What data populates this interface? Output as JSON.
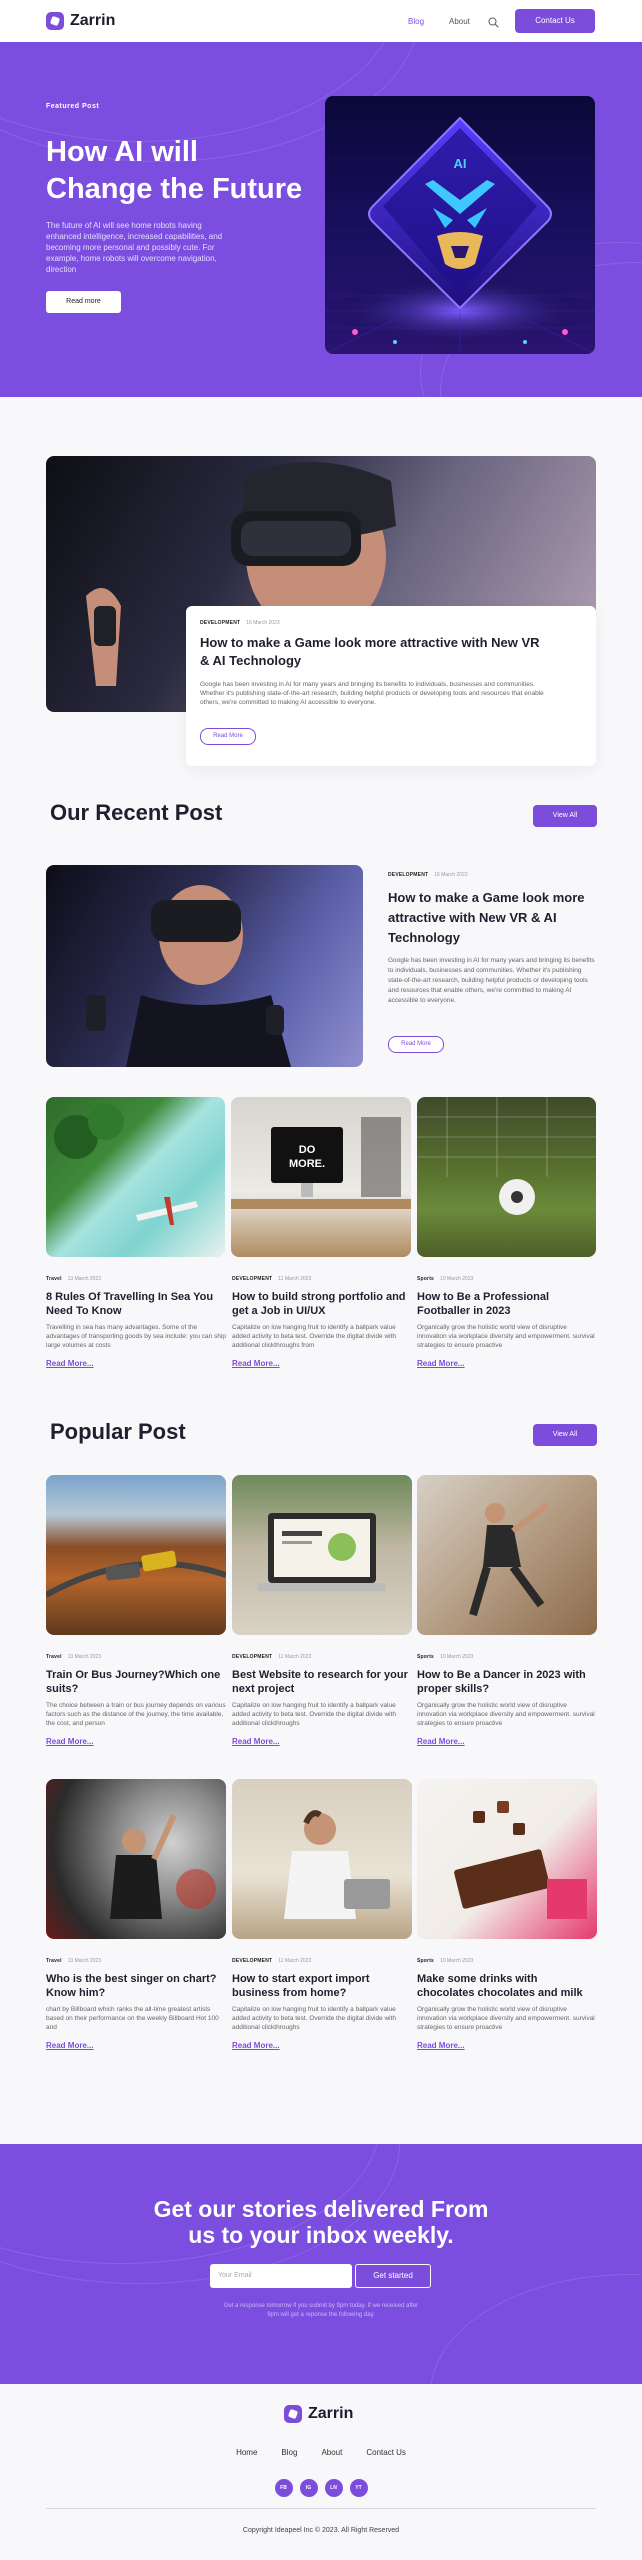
{
  "brand": {
    "name": "Zarrin",
    "accent": "#7c4ddb"
  },
  "nav": {
    "items": [
      "Blog",
      "About"
    ],
    "contact": "Contact Us"
  },
  "hero": {
    "eyebrow": "Featured Post",
    "title_line1": "How AI will",
    "title_line2": "Change the Future",
    "text": "The future of AI will see home robots having enhanced intelligence, increased capabilities, and becoming more personal and possibly cute. For example, home robots will overcome navigation, direction",
    "button": "Read more",
    "image_label": "AI"
  },
  "feature": {
    "tag": "DEVELOPMENT",
    "date": "16 March 2023",
    "title": "How to make a Game look more attractive with New VR & AI Technology",
    "text": "Google has been investing in AI for many years and bringing its benefits to individuals, businesses and communities. Whether it's publishing state-of-the-art research, building helpful products or developing tools and resources that enable others, we're committed to making AI accessible to everyone.",
    "button": "Read More"
  },
  "recent": {
    "title": "Our Recent Post",
    "view_all": "View All",
    "main": {
      "tag": "DEVELOPMENT",
      "date": "16 March 2023",
      "title": "How to make a Game look more attractive with New VR & AI Technology",
      "text": "Google has been investing in AI for many years and bringing its benefits to individuals, businesses and communities. Whether it's publishing state-of-the-art research, building helpful products or developing tools and resources that enable others, we're committed to making AI accessible to everyone.",
      "button": "Read More"
    },
    "cards": [
      {
        "tag": "Travel",
        "date": "13 March 2023",
        "title": "8 Rules Of Travelling In Sea You Need To Know",
        "text": "Travelling in sea has many advantages. Some of the advantages of transporting goods by sea include: you can ship large volumes at costs",
        "link": "Read More..."
      },
      {
        "tag": "DEVELOPMENT",
        "date": "11 March 2023",
        "title": "How to build strong portfolio and get a Job in UI/UX",
        "text": "Capitalize on low hanging fruit to identify a ballpark value added activity to beta test. Override the digital divide with additional clickthroughs from",
        "link": "Read More..."
      },
      {
        "tag": "Sports",
        "date": "10 March 2023",
        "title": "How to Be a Professional Footballer in 2023",
        "text": "Organically grow the holistic world view of disruptive innovation via workplace diversity and empowerment. survival strategies to ensure proactive",
        "link": "Read More..."
      }
    ]
  },
  "popular": {
    "title": "Popular Post",
    "view_all": "View All",
    "cards": [
      {
        "tag": "Travel",
        "date": "13 March 2023",
        "title": "Train Or Bus Journey?Which one suits?",
        "text": "The choice between a train or bus journey depends on various factors such as the distance of the journey, the time available, the cost, and person",
        "link": "Read More..."
      },
      {
        "tag": "DEVELOPMENT",
        "date": "11 March 2023",
        "title": "Best Website to research for your next project",
        "text": "Capitalize on low hanging fruit to identify a ballpark value added activity to beta test. Override the digital divide with additional clickthroughs",
        "link": "Read More..."
      },
      {
        "tag": "Sports",
        "date": "10 March 2023",
        "title": "How to Be a Dancer in 2023 with proper skills?",
        "text": "Organically grow the holistic world view of disruptive innovation via workplace diversity and empowerment. survival strategies to ensure proactive",
        "link": "Read More..."
      },
      {
        "tag": "Travel",
        "date": "13 March 2023",
        "title": "Who is the best singer on chart? Know him?",
        "text": "chart by Billboard which ranks the all-time greatest artists based on their performance on the weekly Billboard Hot 100 and",
        "link": "Read More..."
      },
      {
        "tag": "DEVELOPMENT",
        "date": "11 March 2023",
        "title": "How to start export import business from home?",
        "text": "Capitalize on low hanging fruit to identify a ballpark value added activity to beta test. Override the digital divide with additional clickthroughs",
        "link": "Read More..."
      },
      {
        "tag": "Sports",
        "date": "10 March 2023",
        "title": "Make some drinks with chocolates chocolates and milk",
        "text": "Organically grow the holistic world view of disruptive innovation via workplace diversity and empowerment. survival strategies to ensure proactive",
        "link": "Read More..."
      }
    ]
  },
  "newsletter": {
    "title_line1": "Get our stories delivered From",
    "title_line2": "us to your inbox weekly.",
    "placeholder": "Your Email",
    "button": "Get started",
    "note_line1": "Get a response tomorrow if you submit by 9pm today. If we received after",
    "note_line2": "9pm will get a reponse the following day."
  },
  "footer": {
    "links": [
      "Home",
      "Blog",
      "About",
      "Contact Us"
    ],
    "socials": [
      "FB",
      "IG",
      "LN",
      "YT"
    ],
    "copyright": "Copyright Ideapeel Inc © 2023. All Right Reserved"
  }
}
